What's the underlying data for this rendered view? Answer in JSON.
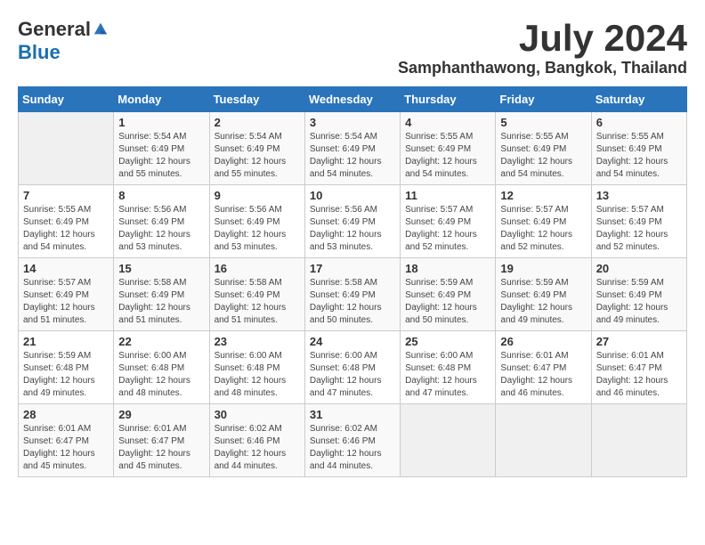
{
  "header": {
    "logo_general": "General",
    "logo_blue": "Blue",
    "month_title": "July 2024",
    "location": "Samphanthawong, Bangkok, Thailand"
  },
  "days_of_week": [
    "Sunday",
    "Monday",
    "Tuesday",
    "Wednesday",
    "Thursday",
    "Friday",
    "Saturday"
  ],
  "weeks": [
    [
      {
        "day": "",
        "empty": true
      },
      {
        "day": "1",
        "sunrise": "Sunrise: 5:54 AM",
        "sunset": "Sunset: 6:49 PM",
        "daylight": "Daylight: 12 hours and 55 minutes."
      },
      {
        "day": "2",
        "sunrise": "Sunrise: 5:54 AM",
        "sunset": "Sunset: 6:49 PM",
        "daylight": "Daylight: 12 hours and 55 minutes."
      },
      {
        "day": "3",
        "sunrise": "Sunrise: 5:54 AM",
        "sunset": "Sunset: 6:49 PM",
        "daylight": "Daylight: 12 hours and 54 minutes."
      },
      {
        "day": "4",
        "sunrise": "Sunrise: 5:55 AM",
        "sunset": "Sunset: 6:49 PM",
        "daylight": "Daylight: 12 hours and 54 minutes."
      },
      {
        "day": "5",
        "sunrise": "Sunrise: 5:55 AM",
        "sunset": "Sunset: 6:49 PM",
        "daylight": "Daylight: 12 hours and 54 minutes."
      },
      {
        "day": "6",
        "sunrise": "Sunrise: 5:55 AM",
        "sunset": "Sunset: 6:49 PM",
        "daylight": "Daylight: 12 hours and 54 minutes."
      }
    ],
    [
      {
        "day": "7",
        "sunrise": "Sunrise: 5:55 AM",
        "sunset": "Sunset: 6:49 PM",
        "daylight": "Daylight: 12 hours and 54 minutes."
      },
      {
        "day": "8",
        "sunrise": "Sunrise: 5:56 AM",
        "sunset": "Sunset: 6:49 PM",
        "daylight": "Daylight: 12 hours and 53 minutes."
      },
      {
        "day": "9",
        "sunrise": "Sunrise: 5:56 AM",
        "sunset": "Sunset: 6:49 PM",
        "daylight": "Daylight: 12 hours and 53 minutes."
      },
      {
        "day": "10",
        "sunrise": "Sunrise: 5:56 AM",
        "sunset": "Sunset: 6:49 PM",
        "daylight": "Daylight: 12 hours and 53 minutes."
      },
      {
        "day": "11",
        "sunrise": "Sunrise: 5:57 AM",
        "sunset": "Sunset: 6:49 PM",
        "daylight": "Daylight: 12 hours and 52 minutes."
      },
      {
        "day": "12",
        "sunrise": "Sunrise: 5:57 AM",
        "sunset": "Sunset: 6:49 PM",
        "daylight": "Daylight: 12 hours and 52 minutes."
      },
      {
        "day": "13",
        "sunrise": "Sunrise: 5:57 AM",
        "sunset": "Sunset: 6:49 PM",
        "daylight": "Daylight: 12 hours and 52 minutes."
      }
    ],
    [
      {
        "day": "14",
        "sunrise": "Sunrise: 5:57 AM",
        "sunset": "Sunset: 6:49 PM",
        "daylight": "Daylight: 12 hours and 51 minutes."
      },
      {
        "day": "15",
        "sunrise": "Sunrise: 5:58 AM",
        "sunset": "Sunset: 6:49 PM",
        "daylight": "Daylight: 12 hours and 51 minutes."
      },
      {
        "day": "16",
        "sunrise": "Sunrise: 5:58 AM",
        "sunset": "Sunset: 6:49 PM",
        "daylight": "Daylight: 12 hours and 51 minutes."
      },
      {
        "day": "17",
        "sunrise": "Sunrise: 5:58 AM",
        "sunset": "Sunset: 6:49 PM",
        "daylight": "Daylight: 12 hours and 50 minutes."
      },
      {
        "day": "18",
        "sunrise": "Sunrise: 5:59 AM",
        "sunset": "Sunset: 6:49 PM",
        "daylight": "Daylight: 12 hours and 50 minutes."
      },
      {
        "day": "19",
        "sunrise": "Sunrise: 5:59 AM",
        "sunset": "Sunset: 6:49 PM",
        "daylight": "Daylight: 12 hours and 49 minutes."
      },
      {
        "day": "20",
        "sunrise": "Sunrise: 5:59 AM",
        "sunset": "Sunset: 6:49 PM",
        "daylight": "Daylight: 12 hours and 49 minutes."
      }
    ],
    [
      {
        "day": "21",
        "sunrise": "Sunrise: 5:59 AM",
        "sunset": "Sunset: 6:48 PM",
        "daylight": "Daylight: 12 hours and 49 minutes."
      },
      {
        "day": "22",
        "sunrise": "Sunrise: 6:00 AM",
        "sunset": "Sunset: 6:48 PM",
        "daylight": "Daylight: 12 hours and 48 minutes."
      },
      {
        "day": "23",
        "sunrise": "Sunrise: 6:00 AM",
        "sunset": "Sunset: 6:48 PM",
        "daylight": "Daylight: 12 hours and 48 minutes."
      },
      {
        "day": "24",
        "sunrise": "Sunrise: 6:00 AM",
        "sunset": "Sunset: 6:48 PM",
        "daylight": "Daylight: 12 hours and 47 minutes."
      },
      {
        "day": "25",
        "sunrise": "Sunrise: 6:00 AM",
        "sunset": "Sunset: 6:48 PM",
        "daylight": "Daylight: 12 hours and 47 minutes."
      },
      {
        "day": "26",
        "sunrise": "Sunrise: 6:01 AM",
        "sunset": "Sunset: 6:47 PM",
        "daylight": "Daylight: 12 hours and 46 minutes."
      },
      {
        "day": "27",
        "sunrise": "Sunrise: 6:01 AM",
        "sunset": "Sunset: 6:47 PM",
        "daylight": "Daylight: 12 hours and 46 minutes."
      }
    ],
    [
      {
        "day": "28",
        "sunrise": "Sunrise: 6:01 AM",
        "sunset": "Sunset: 6:47 PM",
        "daylight": "Daylight: 12 hours and 45 minutes."
      },
      {
        "day": "29",
        "sunrise": "Sunrise: 6:01 AM",
        "sunset": "Sunset: 6:47 PM",
        "daylight": "Daylight: 12 hours and 45 minutes."
      },
      {
        "day": "30",
        "sunrise": "Sunrise: 6:02 AM",
        "sunset": "Sunset: 6:46 PM",
        "daylight": "Daylight: 12 hours and 44 minutes."
      },
      {
        "day": "31",
        "sunrise": "Sunrise: 6:02 AM",
        "sunset": "Sunset: 6:46 PM",
        "daylight": "Daylight: 12 hours and 44 minutes."
      },
      {
        "day": "",
        "empty": true
      },
      {
        "day": "",
        "empty": true
      },
      {
        "day": "",
        "empty": true
      }
    ]
  ]
}
